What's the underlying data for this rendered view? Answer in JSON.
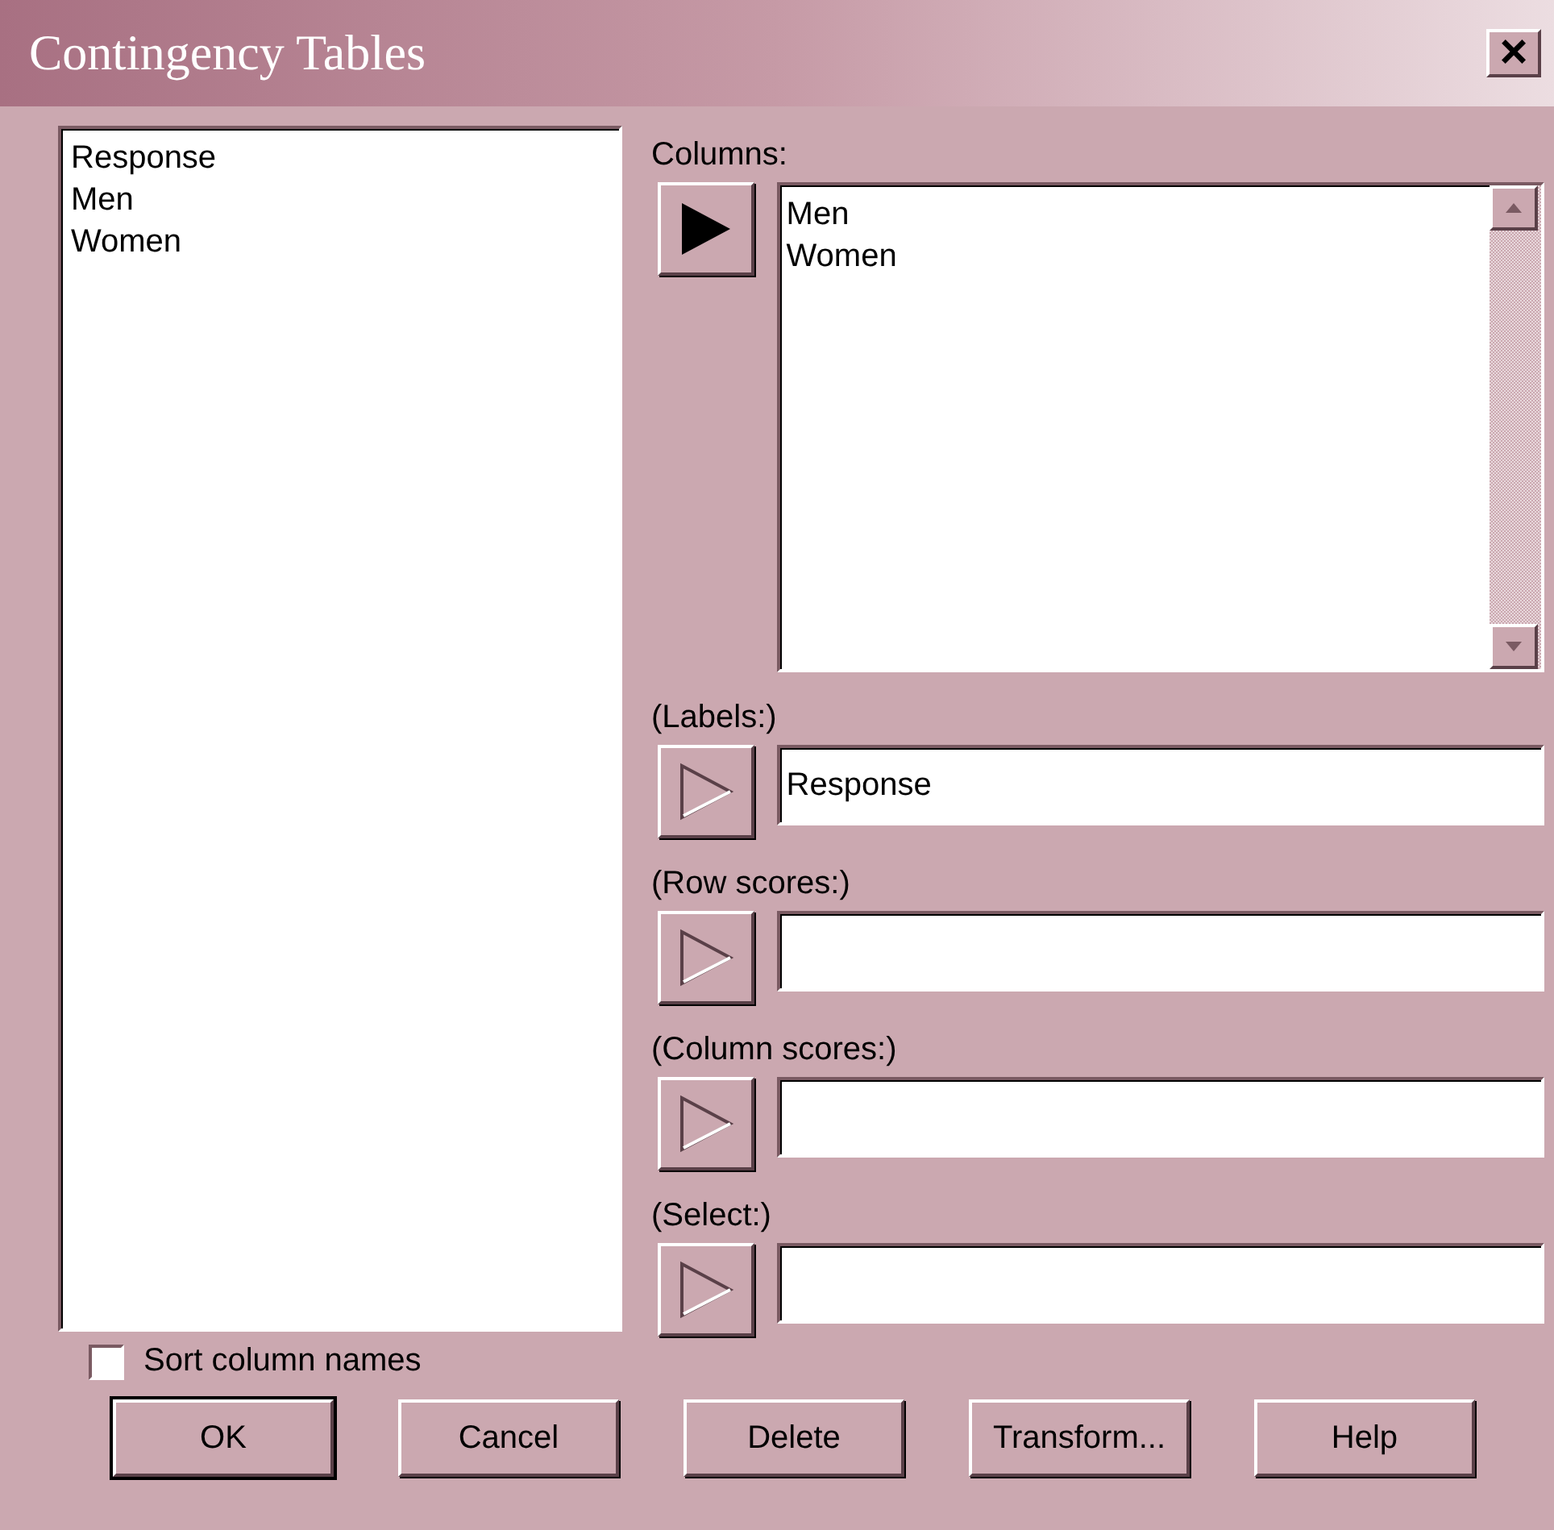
{
  "window": {
    "title": "Contingency Tables",
    "close": "×"
  },
  "variables": [
    "Response",
    "Men",
    "Women"
  ],
  "columns": {
    "label": "Columns:",
    "active": true,
    "items": [
      "Men",
      "Women"
    ]
  },
  "fields": [
    {
      "label": "(Labels:)",
      "active": false,
      "value": "Response"
    },
    {
      "label": "(Row scores:)",
      "active": false
    },
    {
      "label": "(Column scores:)",
      "active": false
    },
    {
      "label": "(Select:)",
      "active": false
    }
  ],
  "sort_checkbox": {
    "label": "Sort column names",
    "checked": false
  },
  "buttons": [
    {
      "label": "OK",
      "default": true
    },
    {
      "label": "Cancel",
      "default": false
    },
    {
      "label": "Delete",
      "default": false
    },
    {
      "label": "Transform...",
      "default": false
    },
    {
      "label": "Help",
      "default": false
    }
  ]
}
